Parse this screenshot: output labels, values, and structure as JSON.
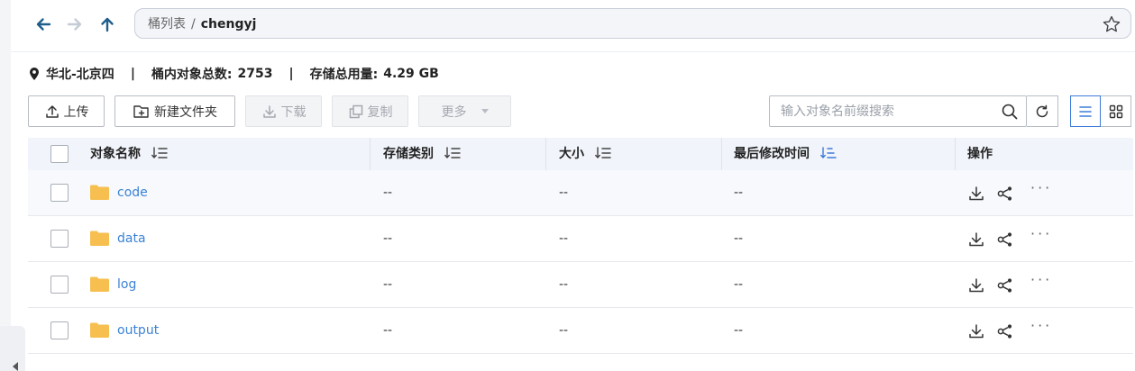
{
  "breadcrumb": {
    "root": "桶列表",
    "separator": "/",
    "current": "chengyj"
  },
  "info": {
    "region": "华北-北京四",
    "separator": "|",
    "object_count_label": "桶内对象总数:",
    "object_count": "2753",
    "storage_label": "存储总用量:",
    "storage_value": "4.29 GB"
  },
  "toolbar": {
    "upload": "上传",
    "new_folder": "新建文件夹",
    "download": "下载",
    "copy": "复制",
    "more": "更多"
  },
  "search": {
    "placeholder": "输入对象名前缀搜索"
  },
  "table": {
    "columns": {
      "name": "对象名称",
      "storage_class": "存储类别",
      "size": "大小",
      "modified": "最后修改时间",
      "actions": "操作"
    },
    "rows": [
      {
        "name": "code",
        "storage_class": "--",
        "size": "--",
        "modified": "--",
        "more": "···"
      },
      {
        "name": "data",
        "storage_class": "--",
        "size": "--",
        "modified": "--",
        "more": "···"
      },
      {
        "name": "log",
        "storage_class": "--",
        "size": "--",
        "modified": "--",
        "more": "···"
      },
      {
        "name": "output",
        "storage_class": "--",
        "size": "--",
        "modified": "--",
        "more": "···"
      }
    ]
  },
  "colors": {
    "accent": "#3b82d6",
    "nav_icon": "#1f5e8c",
    "folder": "#f6bf4f"
  }
}
